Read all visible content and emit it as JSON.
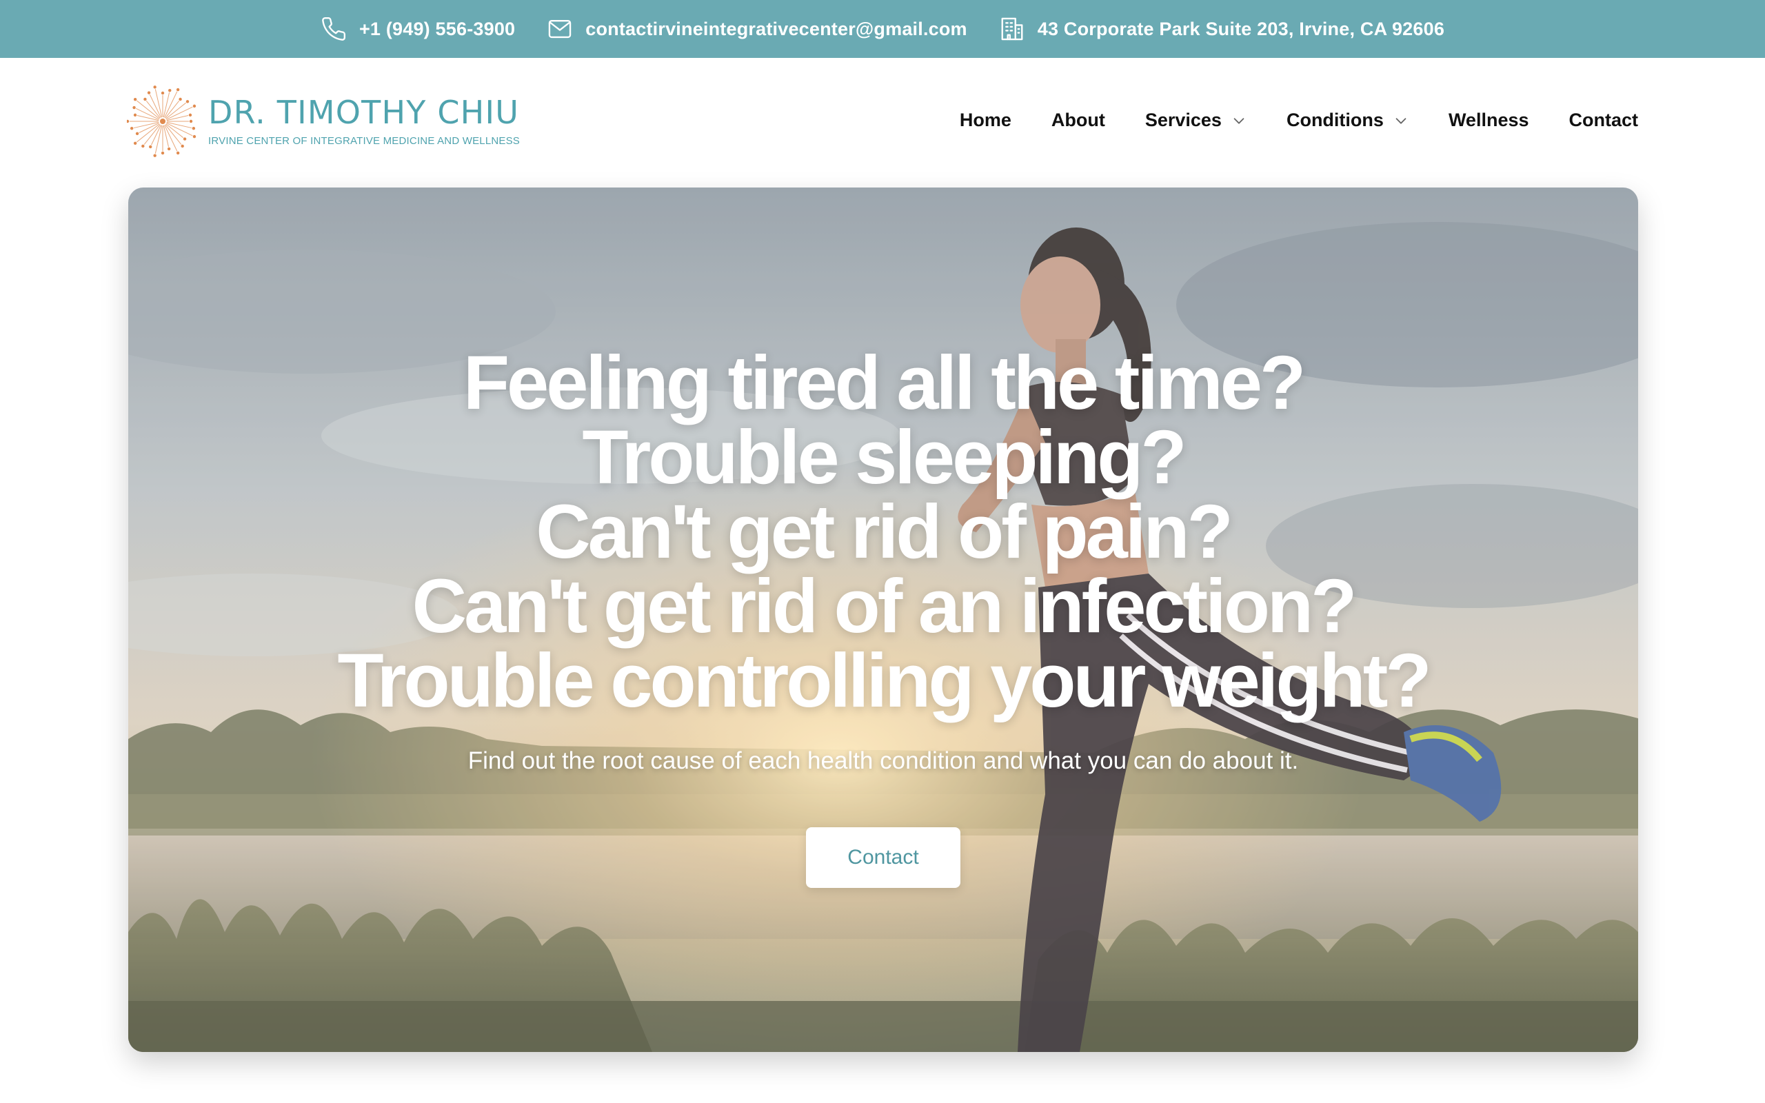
{
  "topbar": {
    "phone": "+1 (949) 556-3900",
    "email": "contactirvineintegrativecenter@gmail.com",
    "address": "43 Corporate Park Suite 203, Irvine, CA 92606"
  },
  "logo": {
    "title": "DR. TIMOTHY CHIU",
    "subtitle": "IRVINE CENTER OF INTEGRATIVE MEDICINE AND WELLNESS"
  },
  "nav": {
    "items": [
      {
        "label": "Home"
      },
      {
        "label": "About"
      },
      {
        "label": "Services",
        "dropdown": true
      },
      {
        "label": "Conditions",
        "dropdown": true
      },
      {
        "label": "Wellness"
      },
      {
        "label": "Contact"
      }
    ]
  },
  "hero": {
    "lines": [
      "Feeling tired all the time?",
      "Trouble sleeping?",
      "Can't get rid of pain?",
      "Can't get rid of an infection?",
      "Trouble controlling your weight?"
    ],
    "subtitle": "Find out the root cause of each health condition and what you can do about it.",
    "button_label": "Contact"
  },
  "colors": {
    "topbar_bg": "#6aaab3",
    "brand_teal": "#4fa3ae",
    "logo_accent": "#e08a4e",
    "button_text": "#4f96a0"
  },
  "icons": {
    "phone": "phone-icon",
    "email": "envelope-icon",
    "address": "building-icon",
    "dropdown": "chevron-down-icon"
  }
}
